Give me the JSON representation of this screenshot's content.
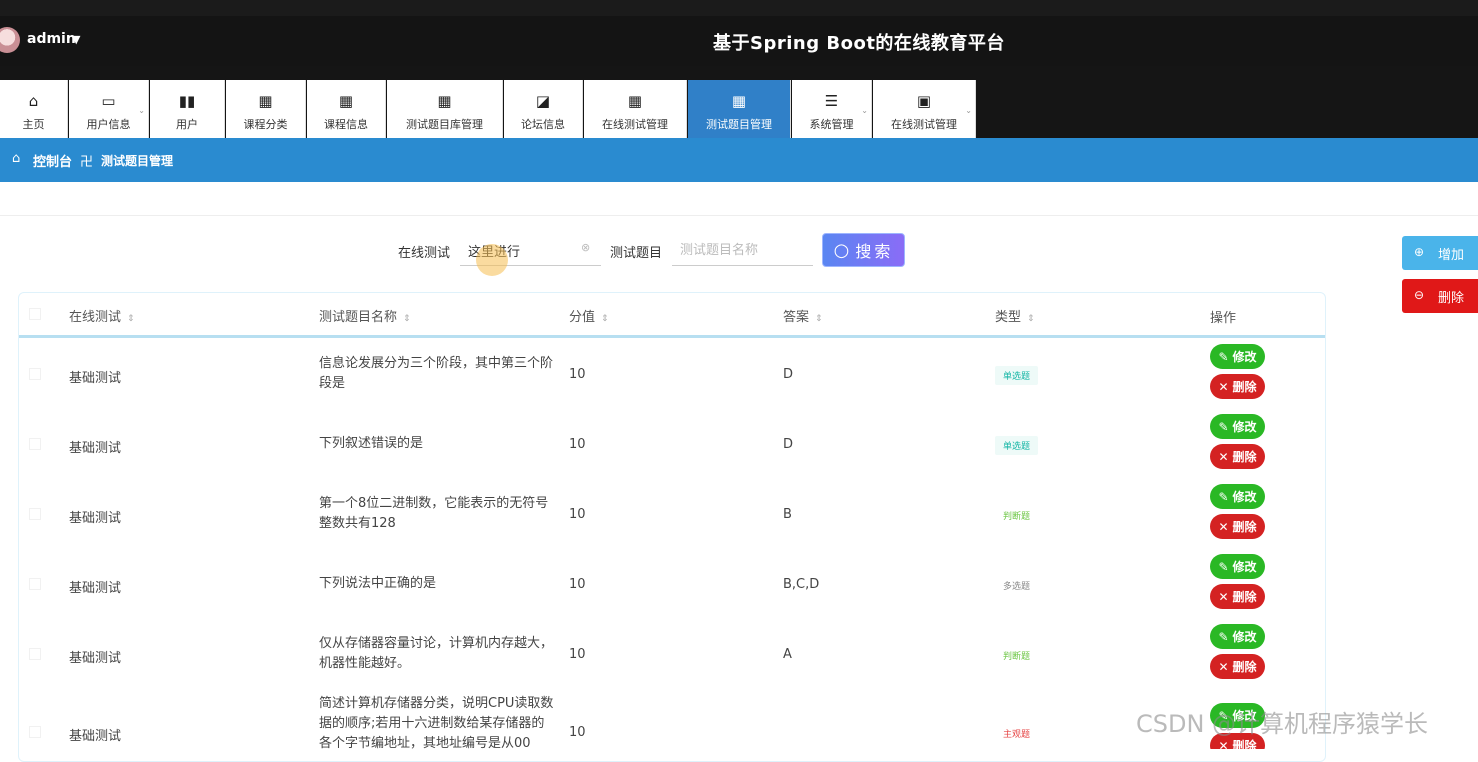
{
  "header": {
    "user": "admin",
    "title": "基于Spring Boot的在线教育平台"
  },
  "nav": [
    {
      "label": "主页",
      "icon": "home-icon"
    },
    {
      "label": "用户信息",
      "icon": "card-icon"
    },
    {
      "label": "用户",
      "icon": "bar-chart-icon"
    },
    {
      "label": "课程分类",
      "icon": "grid-icon"
    },
    {
      "label": "课程信息",
      "icon": "grid-icon"
    },
    {
      "label": "测试题目库管理",
      "icon": "grid-icon"
    },
    {
      "label": "论坛信息",
      "icon": "line-chart-icon"
    },
    {
      "label": "在线测试管理",
      "icon": "grid-icon"
    },
    {
      "label": "测试题目管理",
      "icon": "grid-icon",
      "active": true
    },
    {
      "label": "系统管理",
      "icon": "sliders-icon"
    },
    {
      "label": "在线测试管理",
      "icon": "clipboard-icon"
    }
  ],
  "breadcrumb": {
    "root": "控制台",
    "separator": "卍",
    "current": "测试题目管理"
  },
  "search": {
    "test_label": "在线测试",
    "test_value": "这里进行",
    "question_label": "测试题目",
    "question_placeholder": "测试题目名称",
    "button_label": "搜索"
  },
  "actions": {
    "add_label": "增加",
    "delete_label": "删除"
  },
  "table": {
    "headers": [
      "在线测试",
      "测试题目名称",
      "分值",
      "答案",
      "类型",
      "操作"
    ],
    "rows": [
      {
        "test": "基础测试",
        "question": "信息论发展分为三个阶段，其中第三个阶段是",
        "score": "10",
        "answer": "D",
        "type": "单选题"
      },
      {
        "test": "基础测试",
        "question": "下列叙述错误的是",
        "score": "10",
        "answer": "D",
        "type": "单选题"
      },
      {
        "test": "基础测试",
        "question": "第一个8位二进制数，它能表示的无符号整数共有128",
        "score": "10",
        "answer": "B",
        "type": "判断题"
      },
      {
        "test": "基础测试",
        "question": "下列说法中正确的是",
        "score": "10",
        "answer": "B,C,D",
        "type": "多选题"
      },
      {
        "test": "基础测试",
        "question": "仅从存储器容量讨论，计算机内存越大，机器性能越好。",
        "score": "10",
        "answer": "A",
        "type": "判断题"
      },
      {
        "test": "基础测试",
        "question": "简述计算机存储器分类，说明CPU读取数据的顺序;若用十六进制数给某存储器的各个字节编地址，其地址编号是从00",
        "score": "10",
        "answer": "",
        "type": "主观题"
      }
    ],
    "edit_label": "修改",
    "delete_label": "删除"
  },
  "tag_colors": {
    "单选题": "#13b5a5",
    "判断题": "#6cc644",
    "多选题": "#888888",
    "主观题": "#e64545"
  },
  "watermark": "CSDN @计算机程序猿学长"
}
